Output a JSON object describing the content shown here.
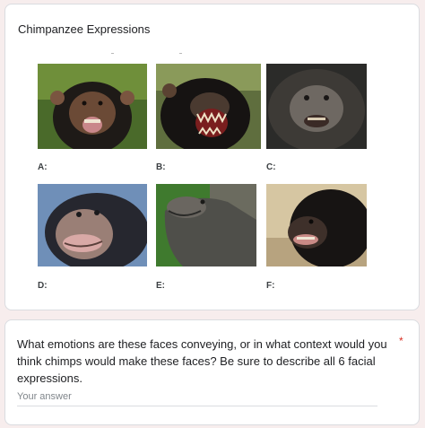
{
  "section": {
    "title": "Chimpanzee Expressions",
    "images": [
      {
        "label": "A:",
        "alt": "chimp-a"
      },
      {
        "label": "B:",
        "alt": "chimp-b"
      },
      {
        "label": "C:",
        "alt": "chimp-c"
      },
      {
        "label": "D:",
        "alt": "chimp-d"
      },
      {
        "label": "E:",
        "alt": "chimp-e"
      },
      {
        "label": "F:",
        "alt": "chimp-f"
      }
    ]
  },
  "question": {
    "text": "What emotions are these faces conveying, or in what context would you think chimps would make these faces? Be sure to describe all 6 facial expressions.",
    "required_mark": "*",
    "answer_placeholder": "Your answer",
    "answer_value": ""
  },
  "colors": {
    "page_background": "#f7eded",
    "card_border": "#dadce0",
    "required": "#d93025"
  }
}
